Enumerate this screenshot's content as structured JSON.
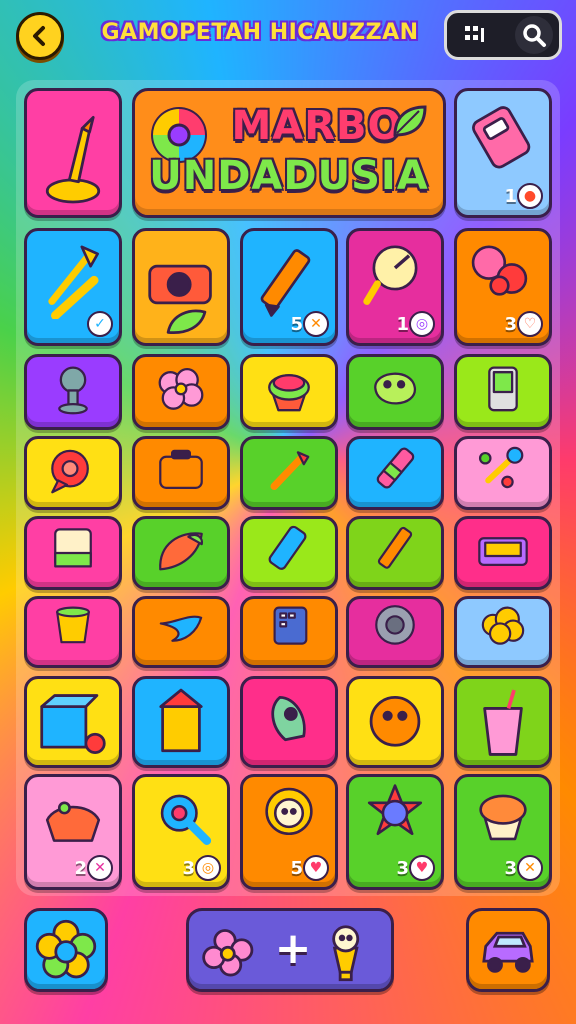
{
  "header": {
    "title": "GAMOPETAH HICAUZZAN",
    "back_icon": "chevron-left-icon",
    "grid_icon": "grid-icon",
    "search_icon": "search-icon"
  },
  "banner": {
    "line1": "MARBO",
    "line2": "UNDADUSIA"
  },
  "tiles": [
    {
      "id": "brush-stand",
      "color": "#ff3fa4"
    },
    {
      "id": "remote",
      "color": "#8ec9ff",
      "count": "1",
      "badge": "●",
      "badge_color": "#ff4a2a"
    },
    {
      "id": "tools",
      "color": "#1fb4ff",
      "badge": "✓",
      "badge_color": "#1fb4ff"
    },
    {
      "id": "camera",
      "color": "#ffb21a"
    },
    {
      "id": "pencil",
      "color": "#1fb4ff",
      "count": "5",
      "badge": "✕",
      "badge_color": "#ff8a00"
    },
    {
      "id": "compass",
      "color": "#e62e9e",
      "count": "1",
      "badge": "◎",
      "badge_color": "#9a3cff"
    },
    {
      "id": "berries",
      "color": "#ff8a00",
      "count": "3",
      "badge": "♡",
      "badge_color": "#ff6a4a"
    },
    {
      "id": "robot",
      "color": "#9a3cff"
    },
    {
      "id": "flower",
      "color": "#ff8a00"
    },
    {
      "id": "cupcake",
      "color": "#ffe014"
    },
    {
      "id": "blob",
      "color": "#58d12a"
    },
    {
      "id": "phone",
      "color": "#9ae81a"
    },
    {
      "id": "pin",
      "color": "#ffe014"
    },
    {
      "id": "suitcase",
      "color": "#ff8a00"
    },
    {
      "id": "wand",
      "color": "#58d12a"
    },
    {
      "id": "marker",
      "color": "#1fb4ff"
    },
    {
      "id": "molecule",
      "color": "#ff9ad6"
    },
    {
      "id": "jar",
      "color": "#ff3fa4"
    },
    {
      "id": "leaf",
      "color": "#58d12a"
    },
    {
      "id": "battery",
      "color": "#9ae81a"
    },
    {
      "id": "crayon",
      "color": "#7fd41a"
    },
    {
      "id": "box",
      "color": "#ff2e8a"
    },
    {
      "id": "cup",
      "color": "#ff3fa4"
    },
    {
      "id": "swirl",
      "color": "#ff8a00"
    },
    {
      "id": "keypad",
      "color": "#ff8a00"
    },
    {
      "id": "gear",
      "color": "#e62e9e"
    },
    {
      "id": "cloud-face",
      "color": "#8ec9ff"
    },
    {
      "id": "cube",
      "color": "#ffe014"
    },
    {
      "id": "building",
      "color": "#1fb4ff"
    },
    {
      "id": "rocket",
      "color": "#ff2e8a"
    },
    {
      "id": "bug",
      "color": "#ffe014"
    },
    {
      "id": "drink",
      "color": "#7fd41a"
    },
    {
      "id": "basket",
      "color": "#ff9ad6",
      "count": "2",
      "badge": "✕",
      "badge_color": "#e62e9e"
    },
    {
      "id": "magnifier",
      "color": "#ffe014",
      "count": "3",
      "badge": "◎",
      "badge_color": "#ff8a00"
    },
    {
      "id": "sunflower",
      "color": "#ff8a00",
      "count": "5",
      "badge": "♥",
      "badge_color": "#ff3b6b"
    },
    {
      "id": "star-ball",
      "color": "#58d12a",
      "count": "3",
      "badge": "♥",
      "badge_color": "#ff3b6b"
    },
    {
      "id": "muffin",
      "color": "#58d12a",
      "count": "3",
      "badge": "✕",
      "badge_color": "#ff8a00"
    }
  ],
  "bottom": {
    "left_button_icon": "flower-icon",
    "combine_plus": "+",
    "right_button_icon": "car-icon"
  }
}
